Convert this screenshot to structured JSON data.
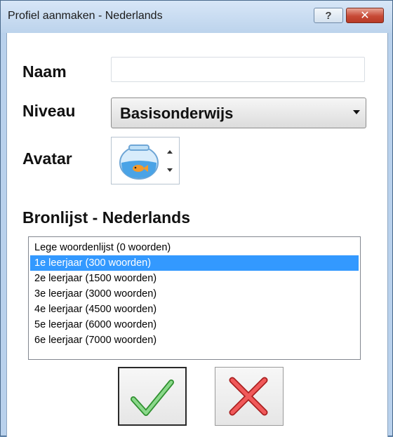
{
  "window": {
    "title": "Profiel aanmaken - Nederlands",
    "help_label": "?",
    "close_label": "✕"
  },
  "form": {
    "name_label": "Naam",
    "name_value": "",
    "level_label": "Niveau",
    "level_value": "Basisonderwijs",
    "avatar_label": "Avatar",
    "avatar_icon": "fishbowl-icon"
  },
  "source": {
    "heading": "Bronlijst - Nederlands",
    "items": [
      "Lege woordenlijst (0 woorden)",
      "1e leerjaar (300 woorden)",
      "2e leerjaar (1500 woorden)",
      "3e leerjaar (3000 woorden)",
      "4e leerjaar (4500 woorden)",
      "5e leerjaar (6000 woorden)",
      "6e leerjaar (7000 woorden)"
    ],
    "selected_index": 1
  },
  "actions": {
    "ok_icon": "checkmark-icon",
    "cancel_icon": "cross-icon"
  },
  "colors": {
    "selection": "#3399ff",
    "ok_green": "#6cc56c",
    "cancel_red": "#e03a3a"
  }
}
